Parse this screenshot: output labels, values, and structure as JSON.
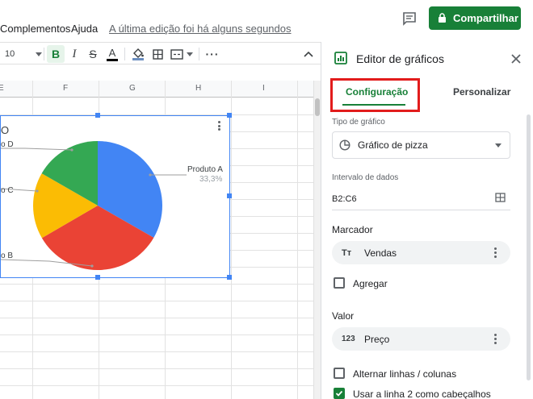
{
  "menu": {
    "items": [
      "Complementos",
      "Ajuda"
    ],
    "last_edit": "A última edição foi há alguns segundos",
    "share_label": "Compartilhar"
  },
  "toolbar": {
    "font_size": "10",
    "icons": [
      "bold-icon",
      "italic-icon",
      "strikethrough-icon",
      "text-color-icon",
      "fill-color-icon",
      "borders-icon",
      "merge-cells-icon",
      "more-icon"
    ]
  },
  "sheet": {
    "columns": [
      "E",
      "F",
      "G",
      "H",
      "I"
    ]
  },
  "chart": {
    "title_fragment": "O",
    "menu_icon": "kebab-icon"
  },
  "chart_data": {
    "type": "pie",
    "title": "",
    "slices": [
      {
        "label": "Produto A",
        "value": 33.3,
        "percent_label": "33,3%",
        "color": "#4285f4"
      },
      {
        "label": "Produto B",
        "value": 33.3,
        "percent_label": "",
        "color": "#ea4335"
      },
      {
        "label": "Produto C",
        "value": 16.7,
        "percent_label": "",
        "color": "#fbbc04"
      },
      {
        "label": "Produto D",
        "value": 16.7,
        "percent_label": "",
        "color": "#34a853"
      }
    ],
    "visible_labels": {
      "a": "Produto A",
      "a_pct": "33,3%",
      "b": "o B",
      "c": "o C",
      "d": "o D"
    }
  },
  "panel": {
    "title": "Editor de gráficos",
    "tabs": {
      "setup": "Configuração",
      "customize": "Personalizar"
    },
    "chart_type_label": "Tipo de gráfico",
    "chart_type_value": "Gráfico de pizza",
    "data_range_label": "Intervalo de dados",
    "data_range_value": "B2:C6",
    "marker_label": "Marcador",
    "marker_value": "Vendas",
    "aggregate_label": "Agregar",
    "value_label": "Valor",
    "value_value": "Preço",
    "switch_rows_label": "Alternar linhas / colunas",
    "use_header_label": "Usar a linha 2 como cabeçalhos"
  },
  "colors": {
    "brand_green": "#188038",
    "selection_blue": "#4285f4",
    "highlight_red": "#e21c1c"
  }
}
